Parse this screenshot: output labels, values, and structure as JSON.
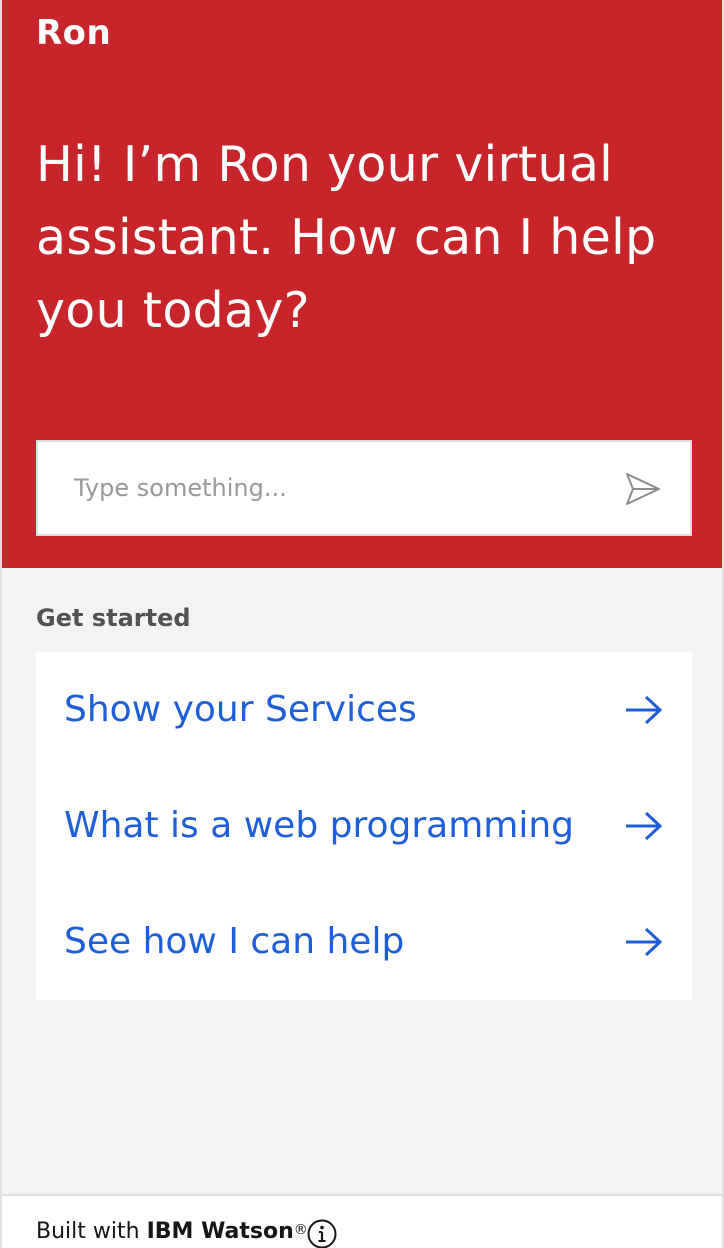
{
  "header": {
    "bot_name": "Ron",
    "greeting": "Hi! I’m Ron your virtual assistant. How can I help you today?",
    "background_color": "#c8252a"
  },
  "input": {
    "placeholder": "Type something...",
    "value": "",
    "send_icon": "send-icon"
  },
  "get_started": {
    "label": "Get started",
    "items": [
      {
        "label": "Show your Services",
        "icon": "arrow-right-icon"
      },
      {
        "label": "What is a web programming",
        "icon": "arrow-right-icon"
      },
      {
        "label": "See how I can help",
        "icon": "arrow-right-icon"
      }
    ],
    "link_color": "#1d5fd9"
  },
  "footer": {
    "prefix": "Built with ",
    "brand": "IBM Watson",
    "registered": "®",
    "info_icon": "info-icon"
  }
}
